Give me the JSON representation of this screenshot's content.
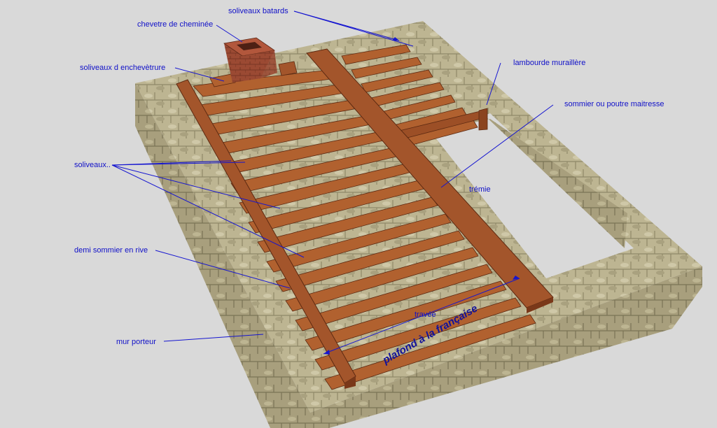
{
  "labels": {
    "soliveaux_batards": "soliveaux batards",
    "chevetre": "chevetre de cheminée",
    "soliveaux_enchevetrure": "soliveaux d enchevètrure",
    "lambourde": "lambourde muraillère",
    "sommier": "sommier ou poutre maitresse",
    "soliveaux": "soliveaux..",
    "tremie": "trémie",
    "demi_sommier": "demi sommier en rive",
    "travee": "travée",
    "mur_porteur": "mur porteur",
    "title": "plafond à la française"
  },
  "colors": {
    "background": "#d9d9d9",
    "stone": "#b9b190",
    "wood": "#a3552b",
    "brick": "#9b4a33",
    "annotation": "#1515d0"
  }
}
